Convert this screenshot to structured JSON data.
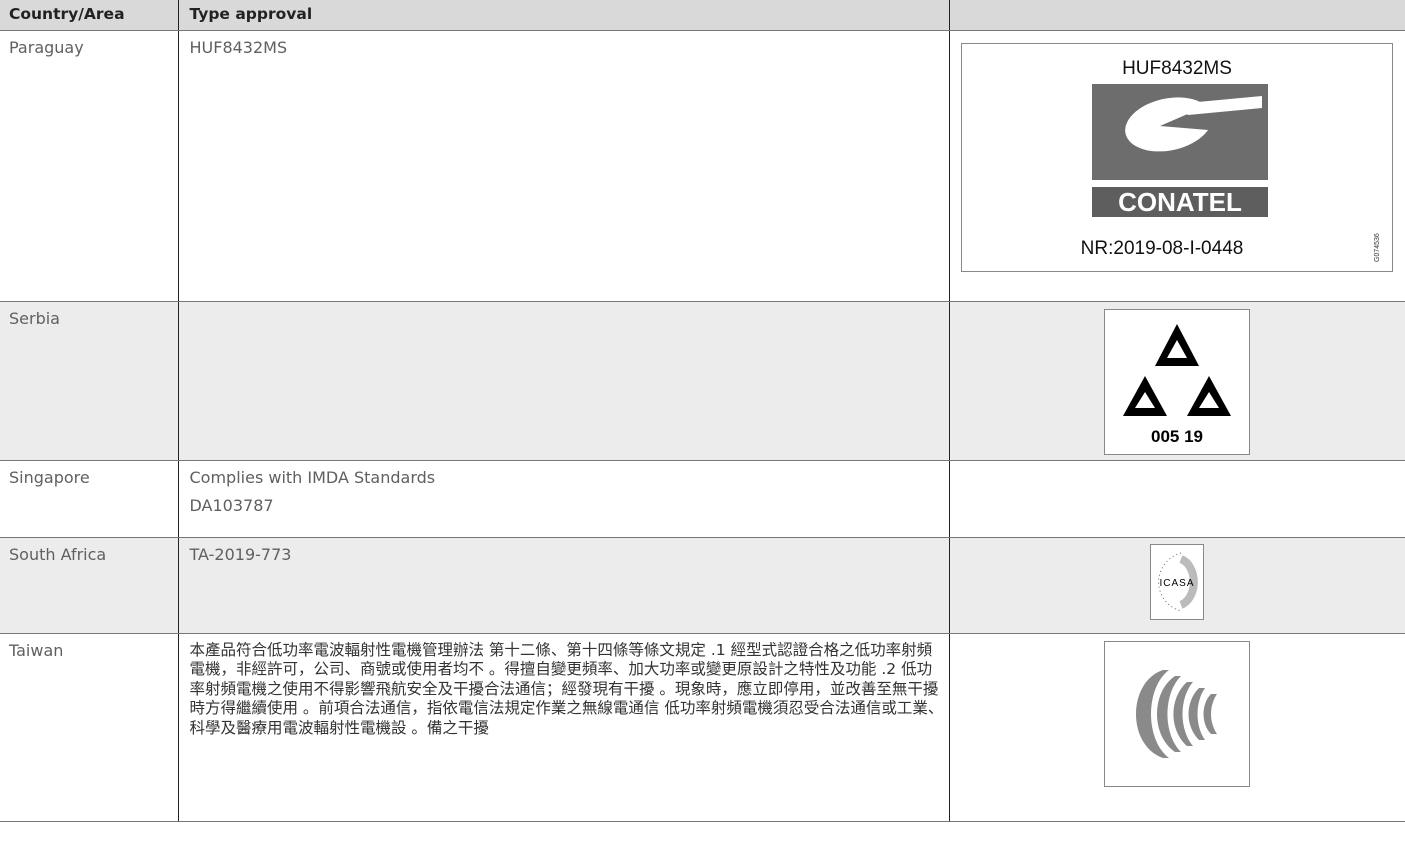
{
  "table": {
    "headers": [
      "Country/Area",
      "Type approval",
      ""
    ],
    "rows": {
      "paraguay": {
        "country": "Paraguay",
        "approval": "HUF8432MS"
      },
      "serbia": {
        "country": "Serbia",
        "approval": ""
      },
      "singapore": {
        "country": "Singapore",
        "approval_lines": [
          "Complies with IMDA Standards",
          "DA103787"
        ]
      },
      "south_africa": {
        "country": "South Africa",
        "approval": "TA-2019-773"
      },
      "taiwan": {
        "country": "Taiwan",
        "approval": "本產品符合低功率電波輻射性電機管理辦法 第十二條、第十四條等條文規定 .1 經型式認證合格之低功率射頻電機，非經許可，公司、商號或使用者均不 。得擅自變更頻率、加大功率或變更原設計之特性及功能 .2 低功率射頻電機之使用不得影響飛航安全及干擾合法通信；經發現有干擾 。現象時，應立即停用，並改善至無干擾時方得繼續使用 。前項合法通信，指依電信法規定作業之無線電通信 低功率射頻電機須忍受合法通信或工業、科學及醫療用電波輻射性電機設 。備之干擾"
      }
    }
  },
  "logos": {
    "paraguay": {
      "title": "HUF8432MS",
      "brand": "CONATEL",
      "number": "NR:2019-08-I-0448",
      "code": "G074536"
    },
    "serbia": {
      "number": "005 19"
    },
    "south_africa": {
      "brand": "ICASA"
    }
  },
  "colors": {
    "header_bg": "#d9d9d9",
    "row_grey": "#ececec",
    "conatel_grey": "#6d6d6d",
    "ncc_grey": "#8a8a8a"
  }
}
